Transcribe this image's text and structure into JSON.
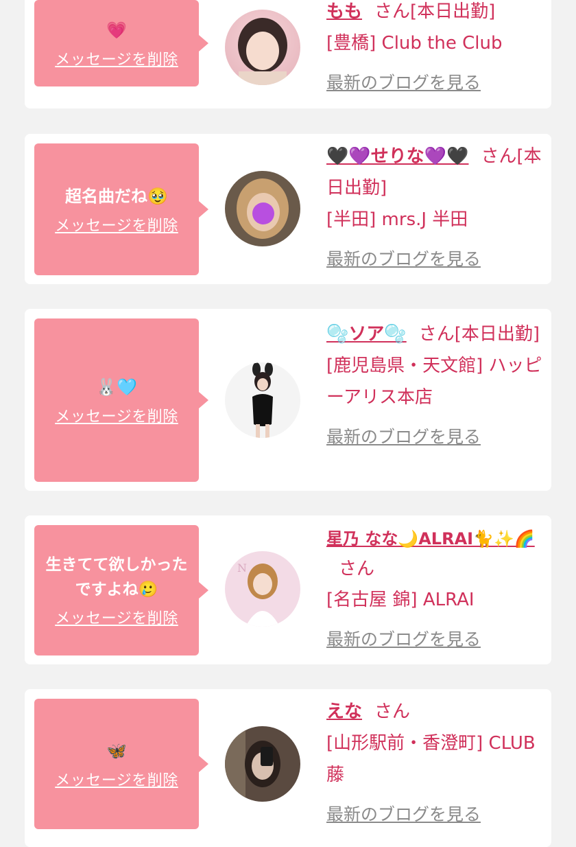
{
  "delete_label": "メッセージを削除",
  "blog_label": "最新のブログを見る",
  "san_label": "さん",
  "cards": [
    {
      "message": "💗",
      "name": "もも",
      "status": "[本日出勤]",
      "shop": "[豊橋] Club the Club"
    },
    {
      "message": "超名曲だね🥹",
      "name": "🖤💜せりな💜🖤",
      "status": "[本日出勤]",
      "shop": "[半田] mrs.J 半田"
    },
    {
      "message": "🐰🩵",
      "name": "🫧ソア🫧",
      "status": "[本日出勤]",
      "shop": "[鹿児島県・天文館] ハッピーアリス本店"
    },
    {
      "message": "生きてて欲しかったですよね🥲",
      "name": "星乃 なな🌙ALRAI🐈✨🌈",
      "status": "",
      "shop": "[名古屋 錦] ALRAI"
    },
    {
      "message": "🦋",
      "name": "えな",
      "status": "",
      "shop": "[山形駅前・香澄町] CLUB 藤"
    }
  ],
  "colors": {
    "bubble": "#f7929e",
    "accent": "#d0305a",
    "link_gray": "#8a8a8a",
    "background": "#f2f2f2"
  }
}
